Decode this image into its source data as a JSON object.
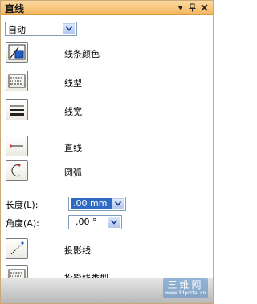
{
  "panel": {
    "title": "直线",
    "title_icons": [
      "pin-icon",
      "dock-icon",
      "close-icon"
    ]
  },
  "mode_select": {
    "value": "自动"
  },
  "buttons": [
    {
      "label": "线条颜色",
      "icon": "line-color-icon"
    },
    {
      "label": "线型",
      "icon": "line-type-icon"
    },
    {
      "label": "线宽",
      "icon": "line-width-icon"
    },
    {
      "label": "直线",
      "icon": "straight-line-icon"
    },
    {
      "label": "圆弧",
      "icon": "arc-icon"
    }
  ],
  "length": {
    "label": "长度(L):",
    "value": ".00 mm"
  },
  "angle": {
    "label": "角度(A):",
    "value": ".00 °"
  },
  "projection": [
    {
      "label": "投影线",
      "icon": "projection-line-icon"
    },
    {
      "label": "投影线类型",
      "icon": "projection-line-type-icon"
    }
  ],
  "watermark": {
    "text": "三维网",
    "sub": "www.3dportal.cn"
  },
  "colors": {
    "title_bg": "#f4b65e",
    "selection": "#316ac5",
    "accent_blue": "#1f5fc6"
  }
}
